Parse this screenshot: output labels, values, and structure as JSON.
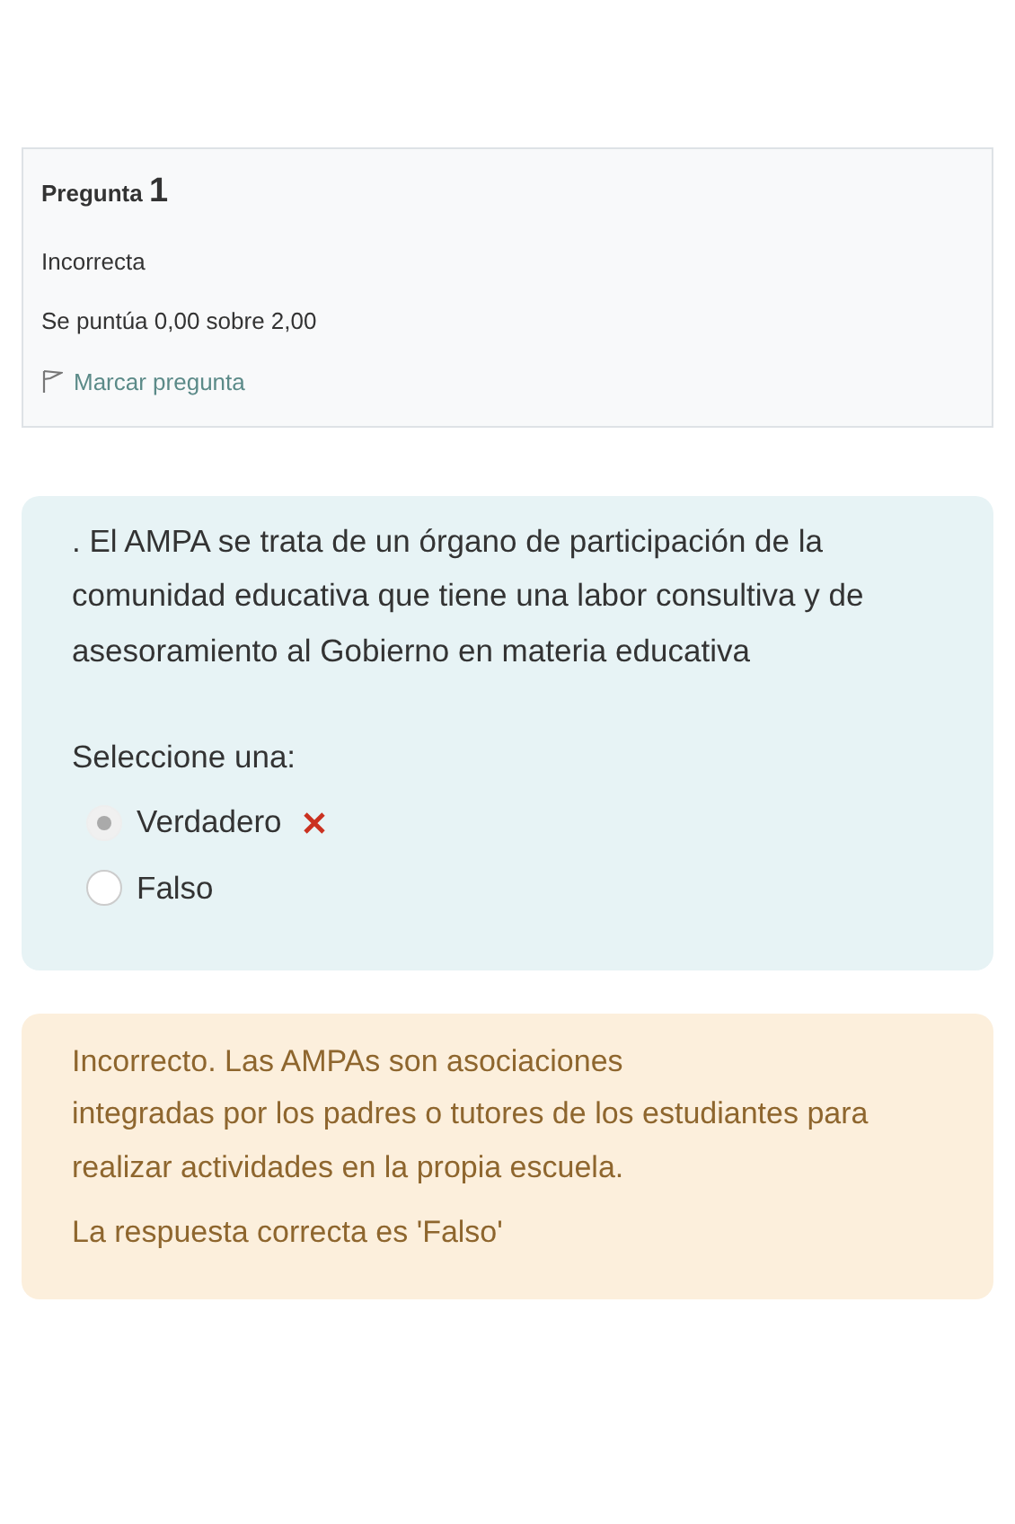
{
  "info": {
    "label": "Pregunta",
    "number": "1",
    "state": "Incorrecta",
    "grade": "Se puntúa 0,00 sobre 2,00",
    "flag": {
      "label": "Marcar pregunta",
      "flagged": false
    }
  },
  "question": {
    "text": ". El AMPA se trata de un órgano de participación de la comunidad educativa que tiene una labor consultiva y de asesoramiento al Gobierno en materia educativa",
    "prompt": "Seleccione una:",
    "options": [
      {
        "label": "Verdadero",
        "selected": true,
        "graded": true,
        "correct": false
      },
      {
        "label": "Falso",
        "selected": false
      }
    ]
  },
  "feedback": {
    "text": "Incorrecto. Las AMPAs son asociaciones\nintegradas por los padres o tutores de los estudiantes para realizar actividades en la propia escuela.",
    "answer": "La respuesta correcta es 'Falso'"
  }
}
